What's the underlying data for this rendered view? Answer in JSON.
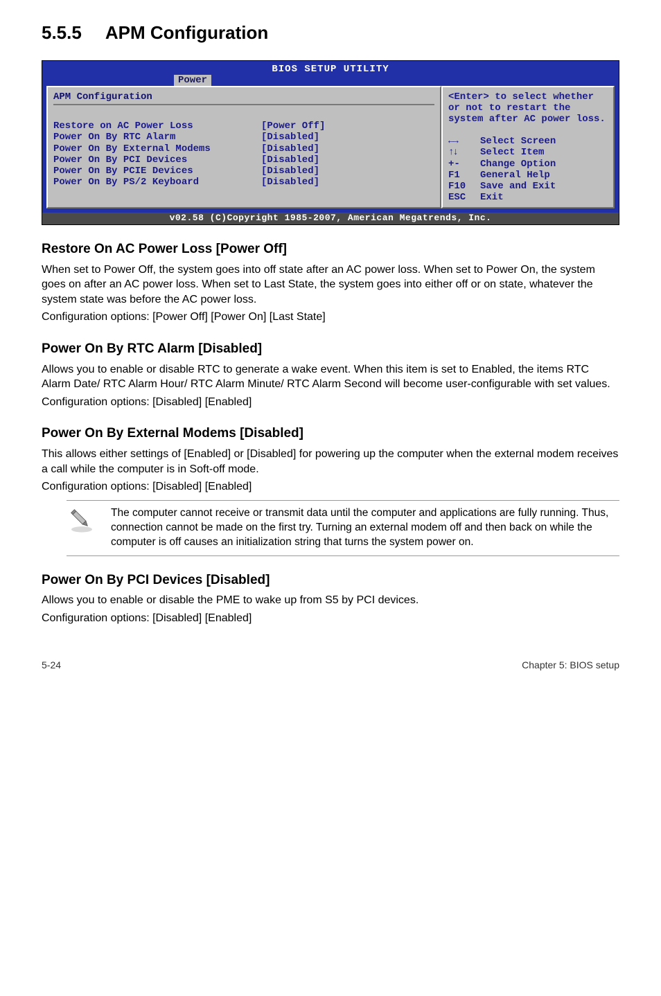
{
  "section": {
    "number": "5.5.5",
    "title": "APM Configuration"
  },
  "bios": {
    "title": "BIOS SETUP UTILITY",
    "tab": "Power",
    "panel_title": "APM Configuration",
    "rows": [
      {
        "label": "Restore on AC Power Loss",
        "value": "[Power Off]"
      },
      {
        "label": "Power On By RTC Alarm",
        "value": "[Disabled]"
      },
      {
        "label": "Power On By External Modems",
        "value": "[Disabled]"
      },
      {
        "label": "Power On By PCI Devices",
        "value": "[Disabled]"
      },
      {
        "label": "Power On By PCIE Devices",
        "value": "[Disabled]"
      },
      {
        "label": "Power On By PS/2 Keyboard",
        "value": "[Disabled]"
      }
    ],
    "help_top": "<Enter> to select whether or not to restart the system after AC power loss.",
    "help_rows": [
      {
        "key_icon": "lr",
        "key": "",
        "text": "Select Screen"
      },
      {
        "key_icon": "ud",
        "key": "",
        "text": "Select Item"
      },
      {
        "key_icon": "",
        "key": "+-",
        "text": "Change Option"
      },
      {
        "key_icon": "",
        "key": "F1",
        "text": "General Help"
      },
      {
        "key_icon": "",
        "key": "F10",
        "text": "Save and Exit"
      },
      {
        "key_icon": "",
        "key": "ESC",
        "text": "Exit"
      }
    ],
    "footer": "v02.58 (C)Copyright 1985-2007, American Megatrends, Inc."
  },
  "subsections": [
    {
      "heading": "Restore On AC Power Loss [Power Off]",
      "paragraphs": [
        "When set to Power Off, the system goes into off state after an AC power loss. When set to Power On, the system goes on after an AC power loss. When set to Last State, the system goes into either off or on state, whatever the system state was before the AC power loss.",
        "Configuration options: [Power Off] [Power On] [Last State]"
      ]
    },
    {
      "heading": "Power On By RTC Alarm [Disabled]",
      "paragraphs": [
        "Allows you to enable or disable RTC to generate a wake event. When this item is set to Enabled, the items RTC Alarm Date/ RTC Alarm Hour/ RTC Alarm Minute/ RTC Alarm Second will become user-configurable with set values.",
        "Configuration options: [Disabled] [Enabled]"
      ]
    },
    {
      "heading": "Power On By External Modems [Disabled]",
      "paragraphs": [
        "This allows either settings of [Enabled] or [Disabled] for powering up the computer when the external modem receives a call while the computer is in Soft-off mode.",
        "Configuration options: [Disabled] [Enabled]"
      ]
    }
  ],
  "note": {
    "text": "The computer cannot receive or transmit data until the computer and applications are fully running. Thus, connection cannot be made on the first try. Turning an external modem off and then back on while the computer is off causes an initialization string that turns the system power on."
  },
  "subsections_after_note": [
    {
      "heading": "Power On By PCI Devices [Disabled]",
      "paragraphs": [
        "Allows you to enable or disable the PME to wake up from S5 by PCI devices.",
        "Configuration options: [Disabled] [Enabled]"
      ]
    }
  ],
  "footer": {
    "left": "5-24",
    "right": "Chapter 5: BIOS setup"
  }
}
